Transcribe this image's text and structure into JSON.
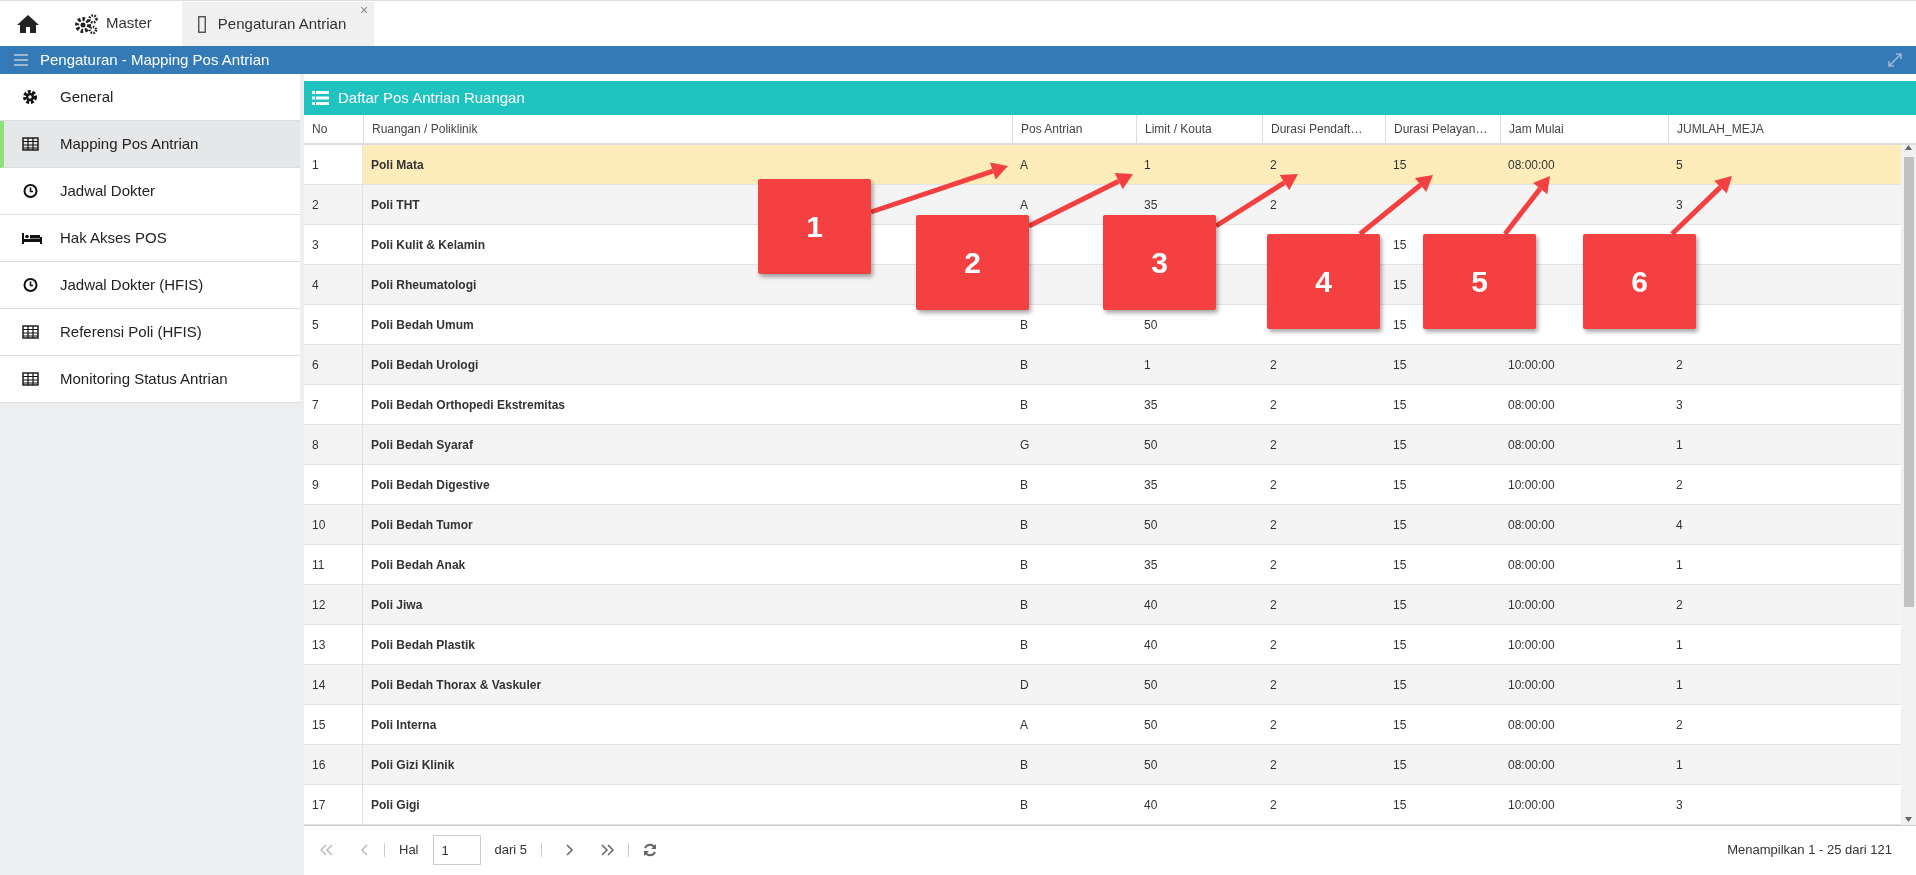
{
  "top_nav": {
    "master_label": "Master",
    "tabs": [
      {
        "label": "Pengaturan Antrian",
        "selected": true,
        "close": "×"
      }
    ]
  },
  "header": {
    "title": "Pengaturan - Mapping Pos Antrian"
  },
  "sidebar": {
    "items": [
      {
        "label": "General",
        "kind": "gear",
        "selected": false
      },
      {
        "label": "Mapping Pos Antrian",
        "kind": "table",
        "selected": true
      },
      {
        "label": "Jadwal Dokter",
        "kind": "clock",
        "selected": false
      },
      {
        "label": "Hak Akses POS",
        "kind": "bed",
        "selected": false
      },
      {
        "label": "Jadwal Dokter (HFIS)",
        "kind": "clock",
        "selected": false
      },
      {
        "label": "Referensi Poli (HFIS)",
        "kind": "table",
        "selected": false
      },
      {
        "label": "Monitoring Status Antrian",
        "kind": "table",
        "selected": false
      }
    ]
  },
  "panel": {
    "title": "Daftar Pos Antrian Ruangan"
  },
  "table": {
    "columns": [
      "No",
      "Ruangan / Poliklinik",
      "Pos Antrian",
      "Limit / Kouta",
      "Durasi Pendaft…",
      "Durasi Pelayan…",
      "Jam Mulai",
      "JUMLAH_MEJA"
    ],
    "rows": [
      {
        "selected": true,
        "cells": [
          "1",
          "Poli Mata",
          "A",
          "1",
          "2",
          "15",
          "08:00:00",
          "5"
        ]
      },
      {
        "selected": false,
        "cells": [
          "2",
          "Poli THT",
          "A",
          "35",
          "2",
          null,
          null,
          "3"
        ]
      },
      {
        "selected": false,
        "cells": [
          "3",
          "Poli Kulit & Kelamin",
          null,
          null,
          null,
          "15",
          null,
          null
        ]
      },
      {
        "selected": false,
        "cells": [
          "4",
          "Poli Rheumatologi",
          null,
          null,
          null,
          "15",
          null,
          null
        ]
      },
      {
        "selected": false,
        "cells": [
          "5",
          "Poli Bedah Umum",
          "B",
          "50",
          null,
          "15",
          null,
          null
        ]
      },
      {
        "selected": false,
        "cells": [
          "6",
          "Poli Bedah Urologi",
          "B",
          "1",
          "2",
          "15",
          "10:00:00",
          "2"
        ]
      },
      {
        "selected": false,
        "cells": [
          "7",
          "Poli Bedah Orthopedi Ekstremitas",
          "B",
          "35",
          "2",
          "15",
          "08:00:00",
          "3"
        ]
      },
      {
        "selected": false,
        "cells": [
          "8",
          "Poli Bedah Syaraf",
          "G",
          "50",
          "2",
          "15",
          "08:00:00",
          "1"
        ]
      },
      {
        "selected": false,
        "cells": [
          "9",
          "Poli Bedah Digestive",
          "B",
          "35",
          "2",
          "15",
          "10:00:00",
          "2"
        ]
      },
      {
        "selected": false,
        "cells": [
          "10",
          "Poli Bedah Tumor",
          "B",
          "50",
          "2",
          "15",
          "08:00:00",
          "4"
        ]
      },
      {
        "selected": false,
        "cells": [
          "11",
          "Poli Bedah Anak",
          "B",
          "35",
          "2",
          "15",
          "08:00:00",
          "1"
        ]
      },
      {
        "selected": false,
        "cells": [
          "12",
          "Poli Jiwa",
          "B",
          "40",
          "2",
          "15",
          "10:00:00",
          "2"
        ]
      },
      {
        "selected": false,
        "cells": [
          "13",
          "Poli Bedah Plastik",
          "B",
          "40",
          "2",
          "15",
          "10:00:00",
          "1"
        ]
      },
      {
        "selected": false,
        "cells": [
          "14",
          "Poli Bedah Thorax & Vaskuler",
          "D",
          "50",
          "2",
          "15",
          "10:00:00",
          "1"
        ]
      },
      {
        "selected": false,
        "cells": [
          "15",
          "Poli Interna",
          "A",
          "50",
          "2",
          "15",
          "08:00:00",
          "2"
        ]
      },
      {
        "selected": false,
        "cells": [
          "16",
          "Poli Gizi Klinik",
          "B",
          "50",
          "2",
          "15",
          "08:00:00",
          "1"
        ]
      },
      {
        "selected": false,
        "cells": [
          "17",
          "Poli Gigi",
          "B",
          "40",
          "2",
          "15",
          "10:00:00",
          "3"
        ]
      }
    ]
  },
  "pagination": {
    "page_label": "Hal",
    "page": "1",
    "page_total": "dari 5",
    "info": "Menampilkan 1 - 25 dari 121"
  },
  "callouts": [
    {
      "label": "1"
    },
    {
      "label": "2"
    },
    {
      "label": "3"
    },
    {
      "label": "4"
    },
    {
      "label": "5"
    },
    {
      "label": "6"
    }
  ]
}
